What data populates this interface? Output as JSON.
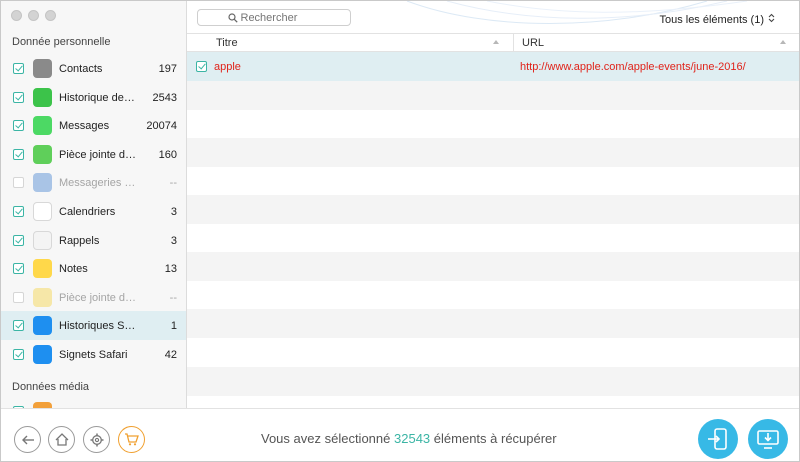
{
  "sidebar": {
    "section_personal": "Donnée personnelle",
    "section_media": "Données média",
    "items": [
      {
        "label": "Contacts",
        "count": "197",
        "icon": "contacts-icon",
        "checked": true,
        "disabled": false,
        "selected": false,
        "color": "#8a8a8a"
      },
      {
        "label": "Historique des a...",
        "count": "2543",
        "icon": "phone-icon",
        "checked": true,
        "disabled": false,
        "selected": false,
        "color": "#3cc34a"
      },
      {
        "label": "Messages",
        "count": "20074",
        "icon": "messages-icon",
        "checked": true,
        "disabled": false,
        "selected": false,
        "color": "#4cd964"
      },
      {
        "label": "Pièce jointe de...",
        "count": "160",
        "icon": "attachment-icon",
        "checked": true,
        "disabled": false,
        "selected": false,
        "color": "#5fcf5a"
      },
      {
        "label": "Messageries Vo...",
        "count": "--",
        "icon": "voicemail-icon",
        "checked": false,
        "disabled": true,
        "selected": false,
        "color": "#a9c4e6"
      },
      {
        "label": "Calendriers",
        "count": "3",
        "icon": "calendar-icon",
        "checked": true,
        "disabled": false,
        "selected": false,
        "color": "#ffffff"
      },
      {
        "label": "Rappels",
        "count": "3",
        "icon": "reminders-icon",
        "checked": true,
        "disabled": false,
        "selected": false,
        "color": "#f4f4f4"
      },
      {
        "label": "Notes",
        "count": "13",
        "icon": "notes-icon",
        "checked": true,
        "disabled": false,
        "selected": false,
        "color": "#ffd84a"
      },
      {
        "label": "Pièce jointe de note",
        "count": "--",
        "icon": "note-attachment-icon",
        "checked": false,
        "disabled": true,
        "selected": false,
        "color": "#f6e7a8"
      },
      {
        "label": "Historiques Safari",
        "count": "1",
        "icon": "safari-history-icon",
        "checked": true,
        "disabled": false,
        "selected": true,
        "color": "#1e8ff0"
      },
      {
        "label": "Signets Safari",
        "count": "42",
        "icon": "safari-bookmarks-icon",
        "checked": true,
        "disabled": false,
        "selected": false,
        "color": "#1e8ff0"
      }
    ]
  },
  "toolbar": {
    "search_placeholder": "Rechercher",
    "filter_label": "Tous les éléments (1)"
  },
  "table": {
    "col_title": "Titre",
    "col_url": "URL",
    "rows": [
      {
        "title": "apple",
        "url": "http://www.apple.com/apple-events/june-2016/",
        "checked": true
      }
    ]
  },
  "footer": {
    "status_prefix": "Vous avez sélectionné",
    "status_count": "32543",
    "status_suffix": "éléments à récupérer"
  },
  "colors": {
    "accent": "#3bb5a5",
    "link_red": "#e0231a",
    "selected_row": "#dfeef2",
    "action_blue": "#37b9e6",
    "cart_orange": "#f0a030"
  }
}
